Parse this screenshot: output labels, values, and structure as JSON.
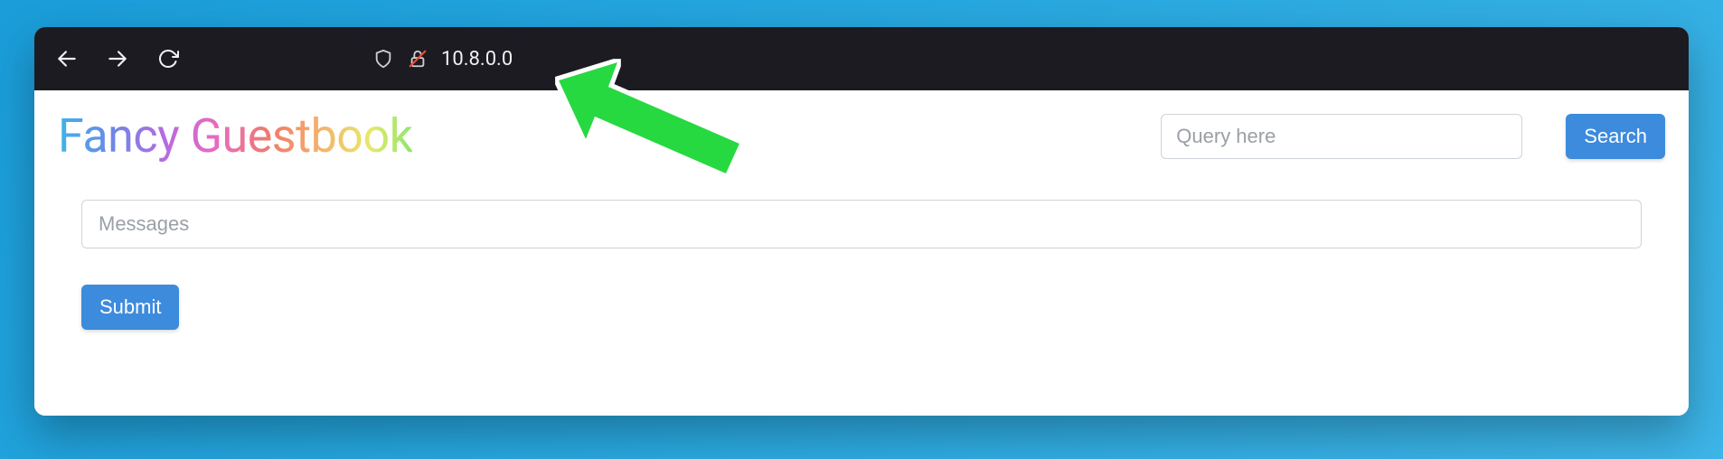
{
  "browser": {
    "url": "10.8.0.0"
  },
  "page": {
    "title": "Fancy Guestbook",
    "search": {
      "placeholder": "Query here",
      "button_label": "Search"
    },
    "form": {
      "messages_placeholder": "Messages",
      "submit_label": "Submit"
    }
  }
}
